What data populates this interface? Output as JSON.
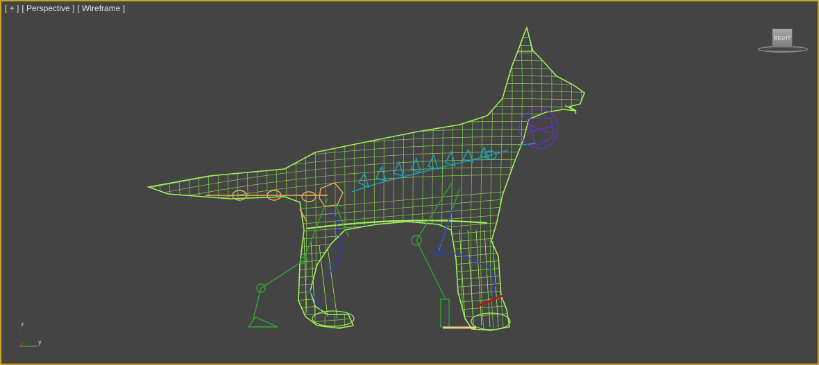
{
  "viewport": {
    "labels": {
      "plus": "[ + ]",
      "view": "[ Perspective ]",
      "shading": "[ Wireframe ]"
    },
    "viewcube": {
      "face_label": "RIGHT"
    },
    "axis": {
      "z": "z",
      "y": "y"
    },
    "colors": {
      "background": "#444444",
      "active_border": "#c8a628",
      "mesh": "#9ef25a",
      "leg_bones": "#2fa62f",
      "spine": "#1aa6b8",
      "tail_bones": "#f2b050",
      "head_rig": "#6a2fd0",
      "ik_chain": "#2a3ae0"
    }
  }
}
